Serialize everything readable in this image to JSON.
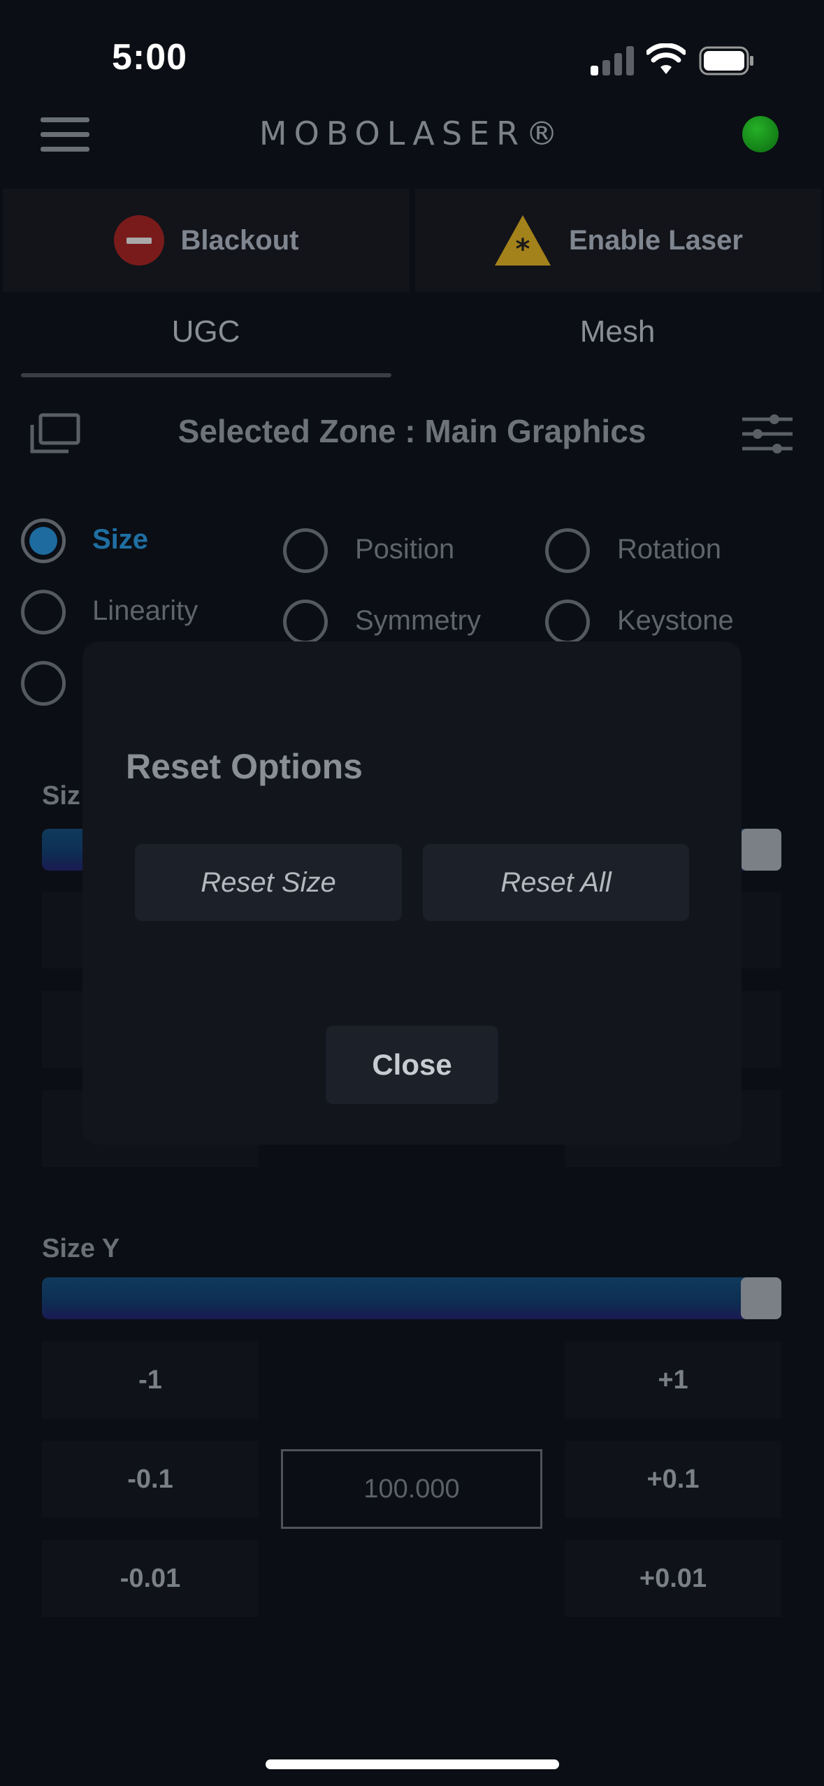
{
  "status_bar": {
    "time": "5:00"
  },
  "header": {
    "brand": "MOBOLASER®"
  },
  "actions": {
    "blackout": "Blackout",
    "enable_laser": "Enable Laser"
  },
  "tabs": [
    {
      "label": "UGC"
    },
    {
      "label": "Mesh"
    }
  ],
  "zone": {
    "title": "Selected Zone : Main Graphics"
  },
  "radios": {
    "size": "Size",
    "position": "Position",
    "rotation": "Rotation",
    "linearity": "Linearity",
    "symmetry": "Symmetry",
    "keystone": "Keystone"
  },
  "size_x": {
    "label_visible": "Siz"
  },
  "size_y": {
    "label": "Size Y",
    "value": "100.000",
    "slider_fraction": 1.0,
    "steps_minus": [
      "-1",
      "-0.1",
      "-0.01"
    ],
    "steps_plus": [
      "+1",
      "+0.1",
      "+0.01"
    ]
  },
  "dialog": {
    "title": "Reset Options",
    "reset_size": "Reset Size",
    "reset_all": "Reset All",
    "close": "Close"
  },
  "colors": {
    "accent": "#1f6fa3",
    "status_online": "#1a9e1d",
    "blackout_red": "#7a1b1b",
    "warning_yellow": "#b08a1a"
  }
}
